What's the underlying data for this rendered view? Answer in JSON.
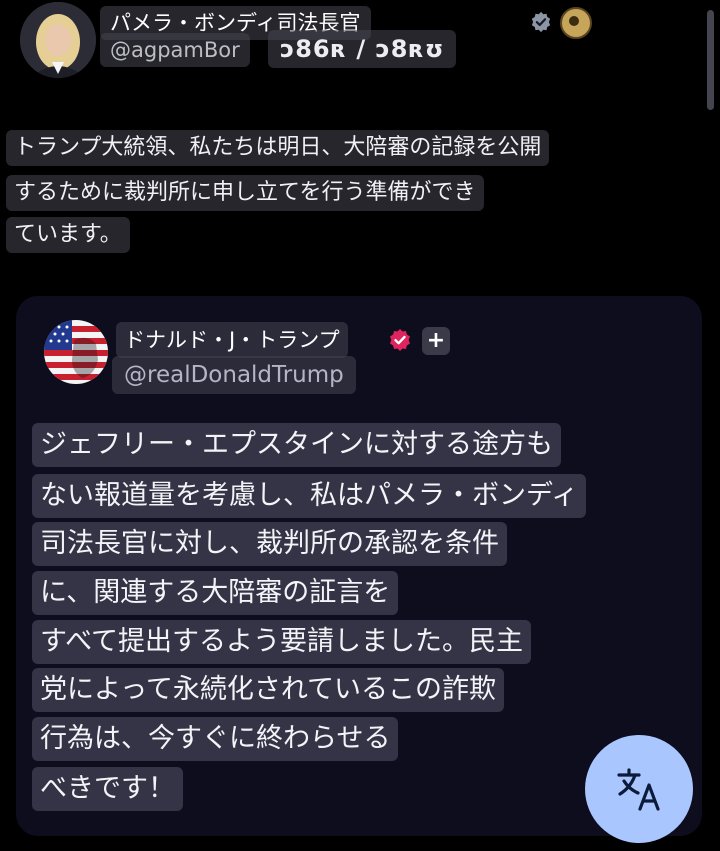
{
  "post": {
    "author_name": "パメラ・ボンディ司法長官",
    "author_handle": "@agpamBor",
    "overlay_digits": "ɔ86ʀ / ɔ8ʀʊ",
    "text_lines": [
      "トランプ大統領、私たちは明日、大陪審の記録を公開",
      "するために裁判所に申し立てを行う準備ができ",
      "ています。"
    ]
  },
  "quoted": {
    "author_name": "ドナルド・J・トランプ",
    "author_handle": "@realDonaldTrump",
    "plus_label": "+",
    "text_lines": [
      "ジェフリー・エプスタインに対する途方も",
      "ない報道量を考慮し、私はパメラ・ボンディ",
      "司法長官に対し、裁判所の承認を条件",
      "に、関連する大陪審の証言を",
      "すべて提出するよう要請しました。民主",
      "党によって永続化されているこの詐欺",
      "行為は、今すぐに終わらせる",
      "べきです！"
    ]
  },
  "icons": {
    "verified_pam": "verified-badge-gray-icon",
    "doj_seal": "doj-seal-icon",
    "verified_trump": "verified-badge-pink-icon",
    "translate": "translate-icon"
  },
  "colors": {
    "background": "#000000",
    "card": "#0e0d1e",
    "chip": "#3a384a",
    "fab": "#a9c6ff",
    "verified_trump": "#e0245e"
  }
}
